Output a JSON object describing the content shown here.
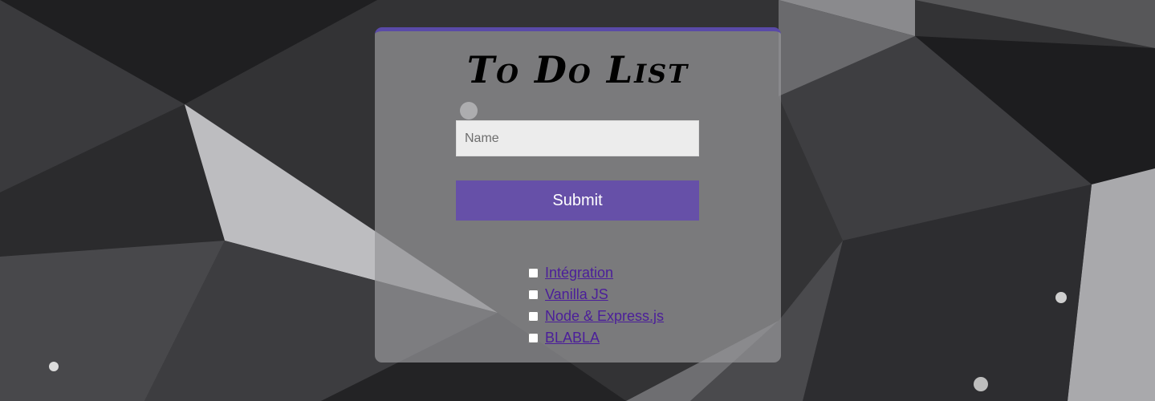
{
  "form": {
    "title": "To Do List",
    "name_placeholder": "Name",
    "name_value": "",
    "submit_label": "Submit"
  },
  "todos": [
    {
      "label": "Intégration",
      "checked": false
    },
    {
      "label": "Vanilla JS",
      "checked": false
    },
    {
      "label": "Node & Express.js",
      "checked": false
    },
    {
      "label": "BLABLA",
      "checked": false
    }
  ],
  "colors": {
    "accent": "#6650a8",
    "card": "#969698",
    "link": "#4b1e9a"
  }
}
